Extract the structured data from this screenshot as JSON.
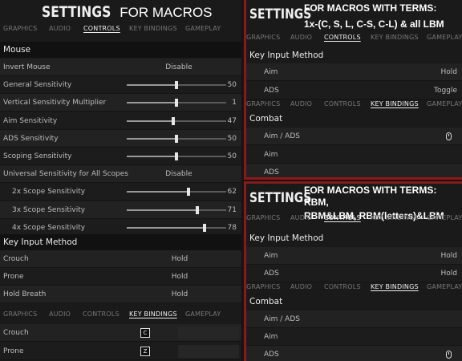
{
  "left": {
    "title_settings": "SETTINGS",
    "title_rest": "FOR MACROS",
    "tabs": [
      "GRAPHICS",
      "AUDIO",
      "CONTROLS",
      "KEY BINDINGS",
      "GAMEPLAY"
    ],
    "mouse_section": "Mouse",
    "rows": [
      {
        "label": "Invert Mouse",
        "value": "Disable"
      },
      {
        "label": "General Sensitivity",
        "value": "50",
        "level": 0.5
      },
      {
        "label": "Vertical Sensitivity Multiplier",
        "value": "1",
        "level": 0.5
      },
      {
        "label": "Aim Sensitivity",
        "value": "47",
        "level": 0.47
      },
      {
        "label": "ADS Sensitivity",
        "value": "50",
        "level": 0.5
      },
      {
        "label": "Scoping Sensitivity",
        "value": "50",
        "level": 0.5
      },
      {
        "label": "Universal Sensitivity for All Scopes",
        "value": "Disable"
      },
      {
        "label": "2x Scope Sensitivity",
        "value": "62",
        "level": 0.62
      },
      {
        "label": "3x Scope Sensitivity",
        "value": "71",
        "level": 0.71
      },
      {
        "label": "4x Scope Sensitivity",
        "value": "78",
        "level": 0.78
      }
    ],
    "key_input_section": "Key Input Method",
    "key_rows": [
      {
        "label": "Crouch",
        "value": "Hold"
      },
      {
        "label": "Prone",
        "value": "Hold"
      },
      {
        "label": "Hold Breath",
        "value": "Hold"
      }
    ],
    "tabs2": [
      "GRAPHICS",
      "AUDIO",
      "CONTROLS",
      "KEY BINDINGS",
      "GAMEPLAY"
    ],
    "bind_rows": [
      {
        "label": "Crouch",
        "key": "C"
      },
      {
        "label": "Prone",
        "key": "Z"
      }
    ]
  },
  "top_right": {
    "title_settings": "SETTINGS",
    "note": [
      "FOR MACROS WITH TERMS:",
      "1x-(C, S, L, C-S, C-L) & all LBM"
    ],
    "tabs": [
      "GRAPHICS",
      "AUDIO",
      "CONTROLS",
      "KEY BINDINGS",
      "GAMEPLAY"
    ],
    "key_input_section": "Key Input Method",
    "key_rows": [
      {
        "label": "Aim",
        "value": "Hold"
      },
      {
        "label": "ADS",
        "value": "Toggle"
      }
    ],
    "tabs2": [
      "GRAPHICS",
      "AUDIO",
      "CONTROLS",
      "KEY BINDINGS",
      "GAMEPLAY"
    ],
    "combat_section": "Combat",
    "combat_rows": [
      "Aim / ADS",
      "Aim",
      "ADS"
    ]
  },
  "bottom_right": {
    "title_settings": "SETTINGS",
    "note": [
      "FOR MACROS WITH TERMS: RBM,",
      "RBM&LBM, RBM(letters)&LBM"
    ],
    "tabs": [
      "GRAPHICS",
      "AUDIO",
      "CONTROLS",
      "KEY BINDINGS",
      "GAMEPLAY"
    ],
    "key_input_section": "Key Input Method",
    "key_rows": [
      {
        "label": "Aim",
        "value": "Hold"
      },
      {
        "label": "ADS",
        "value": "Hold"
      }
    ],
    "tabs2": [
      "GRAPHICS",
      "AUDIO",
      "CONTROLS",
      "KEY BINDINGS",
      "GAMEPLAY"
    ],
    "combat_section": "Combat",
    "combat_rows": [
      "Aim / ADS",
      "Aim",
      "ADS"
    ]
  }
}
